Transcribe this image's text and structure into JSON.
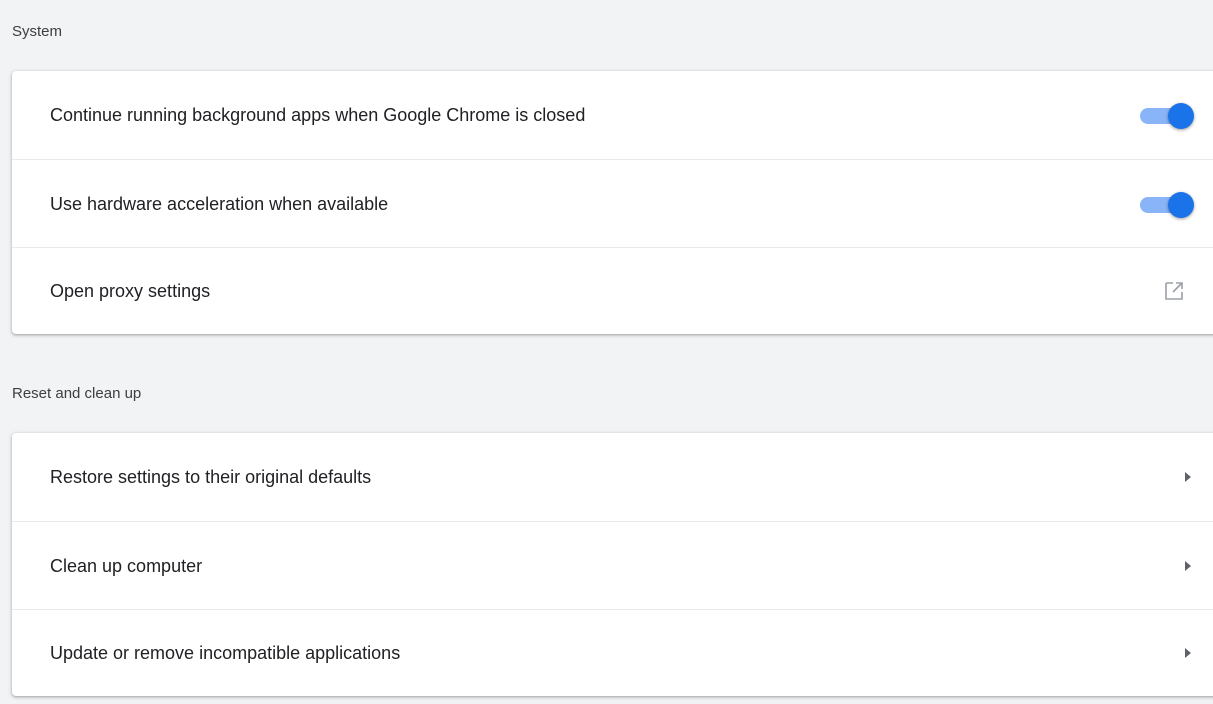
{
  "system": {
    "title": "System",
    "rows": [
      {
        "label": "Continue running background apps when Google Chrome is closed",
        "control": "toggle",
        "checked": true
      },
      {
        "label": "Use hardware acceleration when available",
        "control": "toggle",
        "checked": true
      },
      {
        "label": "Open proxy settings",
        "control": "open-in-new-icon"
      }
    ]
  },
  "reset": {
    "title": "Reset and clean up",
    "rows": [
      {
        "label": "Restore settings to their original defaults",
        "control": "arrow-right-icon"
      },
      {
        "label": "Clean up computer",
        "control": "arrow-right-icon"
      },
      {
        "label": "Update or remove incompatible applications",
        "control": "arrow-right-icon"
      }
    ]
  },
  "colors": {
    "page_background": "#f1f3f4",
    "toggle_track": "#8ab4f8",
    "toggle_knob": "#1a73e8",
    "icon_gray": "#5f6368"
  }
}
